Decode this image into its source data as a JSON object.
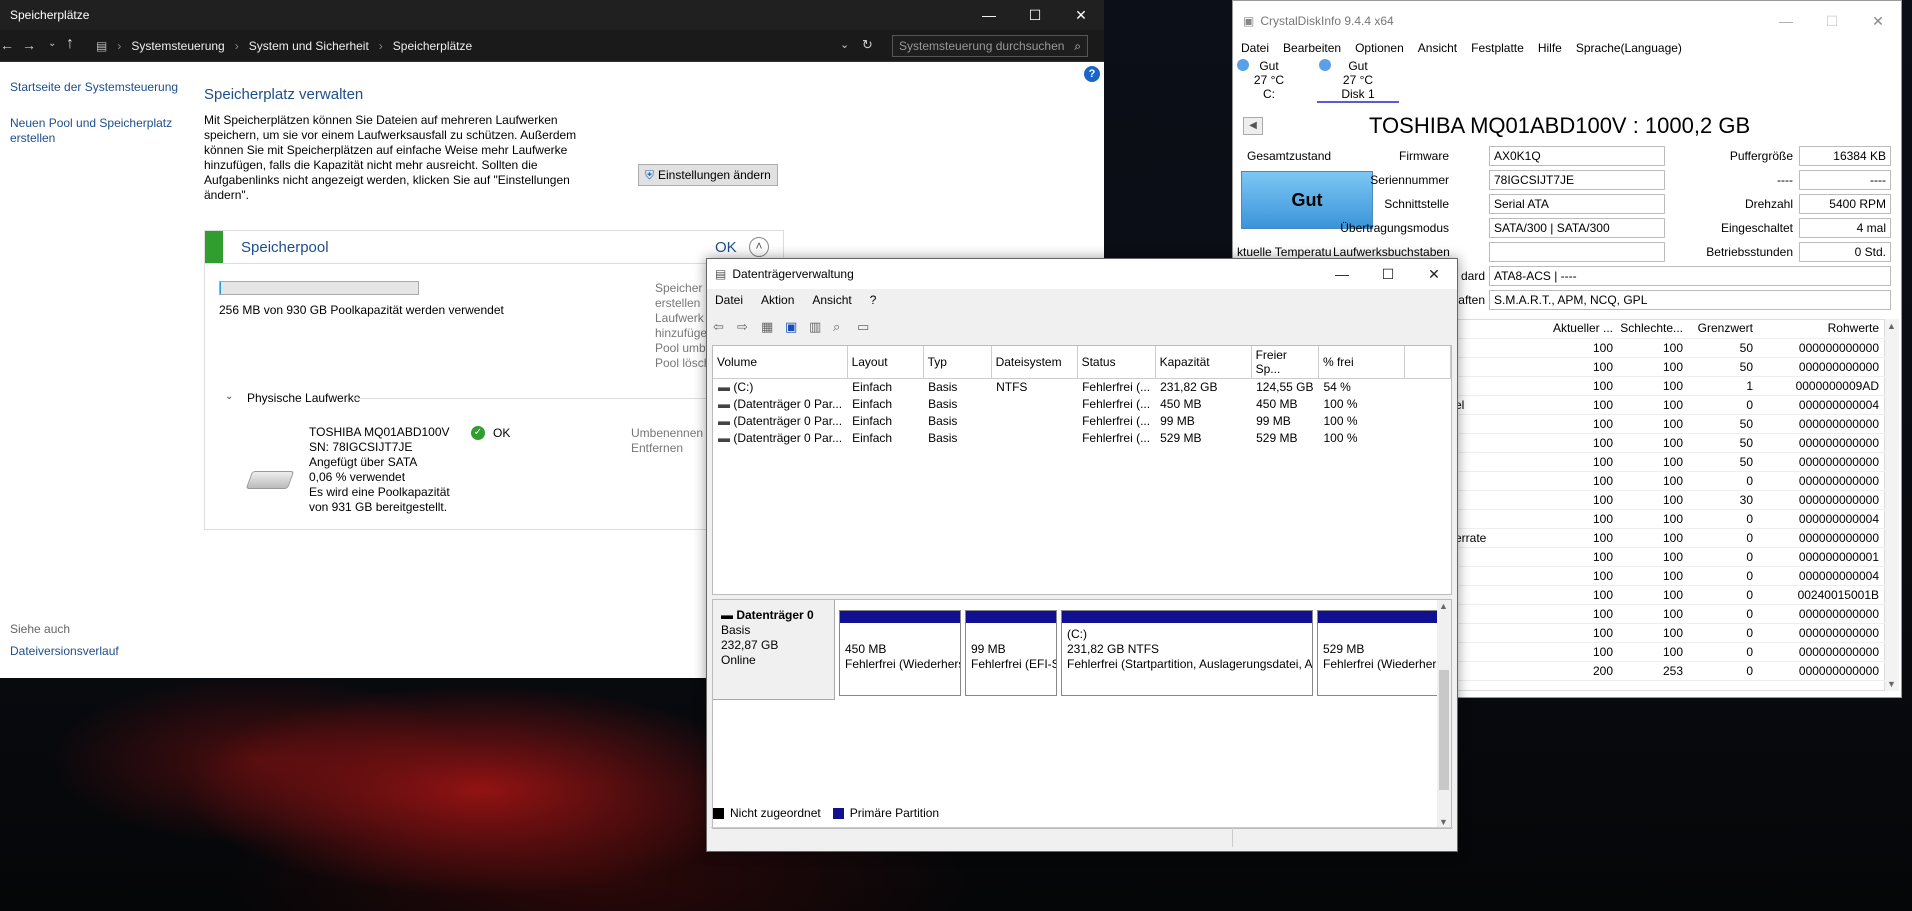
{
  "storage_spaces": {
    "window_title": "Speicherplätze",
    "breadcrumb": [
      "Systemsteuerung",
      "System und Sicherheit",
      "Speicherplätze"
    ],
    "search_placeholder": "Systemsteuerung durchsuchen",
    "side_links": [
      "Startseite der Systemsteuerung",
      "Neuen Pool und Speicherplatz erstellen"
    ],
    "see_also_label": "Siehe auch",
    "see_also_link": "Dateiversionsverlauf",
    "heading": "Speicherplatz verwalten",
    "description": "Mit Speicherplätzen können Sie Dateien auf mehreren Laufwerken speichern, um sie vor einem Laufwerksausfall zu schützen. Außerdem können Sie mit Speicherplätzen auf einfache Weise mehr Laufwerke hinzufügen, falls die Kapazität nicht mehr ausreicht. Sollten die Aufgabenlinks nicht angezeigt werden, klicken Sie auf \"Einstellungen ändern\".",
    "settings_button": "Einstellungen ändern",
    "pool": {
      "title": "Speicherpool",
      "status": "OK",
      "usage_text": "256 MB von 930 GB Poolkapazität werden verwendet",
      "usage_fraction": 0.0003,
      "pool_links": [
        "Speicher",
        "erstellen",
        "Laufwerk",
        "hinzufüge",
        "Pool umb",
        "Pool lösch"
      ],
      "physical_label": "Physische Laufwerke",
      "drive": {
        "name": "TOSHIBA MQ01ABD100V",
        "sn": "SN: 78IGCSIJT7JE",
        "attached": "Angefügt über SATA",
        "used": "0,06 % verwendet",
        "provided_1": "Es wird eine Poolkapazität",
        "provided_2": "von 931 GB bereitgestellt.",
        "status": "OK",
        "actions": [
          "Umbenennen",
          "Entfernen"
        ]
      }
    }
  },
  "crystal": {
    "window_title": "CrystalDiskInfo 9.4.4 x64",
    "menu": [
      "Datei",
      "Bearbeiten",
      "Optionen",
      "Ansicht",
      "Festplatte",
      "Hilfe",
      "Sprache(Language)"
    ],
    "disk_tabs": [
      {
        "status": "Gut",
        "temp": "27 °C",
        "label": "C:"
      },
      {
        "status": "Gut",
        "temp": "27 °C",
        "label": "Disk 1"
      }
    ],
    "model": "TOSHIBA MQ01ABD100V : 1000,2 GB",
    "health_label": "Gesamtzustand",
    "health_value": "Gut",
    "temp_label": "ktuelle Temperatu",
    "fields": [
      {
        "label": "Firmware",
        "value": "AX0K1Q"
      },
      {
        "label": "Seriennummer",
        "value": "78IGCSIJT7JE"
      },
      {
        "label": "Schnittstelle",
        "value": "Serial ATA"
      },
      {
        "label": "Übertragungsmodus",
        "value": "SATA/300 | SATA/300"
      },
      {
        "label": "Laufwerksbuchstaben",
        "value": ""
      },
      {
        "label": "dard",
        "value": "ATA8-ACS | ----"
      },
      {
        "label": "aften",
        "value": "S.M.A.R.T., APM, NCQ, GPL"
      }
    ],
    "right_fields": [
      {
        "label": "Puffergröße",
        "value": "16384 KB"
      },
      {
        "label": "----",
        "value": "----"
      },
      {
        "label": "Drehzahl",
        "value": "5400 RPM"
      },
      {
        "label": "Eingeschaltet",
        "value": "4 mal"
      },
      {
        "label": "Betriebsstunden",
        "value": "0 Std."
      }
    ],
    "smart_headers": [
      "Aktueller ...",
      "Schlechte...",
      "Grenzwert",
      "Rohwerte"
    ],
    "smart_rows": [
      {
        "name": "",
        "cur": "100",
        "worst": "100",
        "thr": "50",
        "raw": "000000000000"
      },
      {
        "name": "",
        "cur": "100",
        "worst": "100",
        "thr": "50",
        "raw": "000000000000"
      },
      {
        "name": "",
        "cur": "100",
        "worst": "100",
        "thr": "1",
        "raw": "0000000009AD"
      },
      {
        "name": "el",
        "cur": "100",
        "worst": "100",
        "thr": "0",
        "raw": "000000000004"
      },
      {
        "name": "",
        "cur": "100",
        "worst": "100",
        "thr": "50",
        "raw": "000000000000"
      },
      {
        "name": "",
        "cur": "100",
        "worst": "100",
        "thr": "50",
        "raw": "000000000000"
      },
      {
        "name": "",
        "cur": "100",
        "worst": "100",
        "thr": "50",
        "raw": "000000000000"
      },
      {
        "name": "",
        "cur": "100",
        "worst": "100",
        "thr": "0",
        "raw": "000000000000"
      },
      {
        "name": "",
        "cur": "100",
        "worst": "100",
        "thr": "30",
        "raw": "000000000000"
      },
      {
        "name": "",
        "cur": "100",
        "worst": "100",
        "thr": "0",
        "raw": "000000000004"
      },
      {
        "name": "errate",
        "cur": "100",
        "worst": "100",
        "thr": "0",
        "raw": "000000000000"
      },
      {
        "name": "",
        "cur": "100",
        "worst": "100",
        "thr": "0",
        "raw": "000000000001"
      },
      {
        "name": "",
        "cur": "100",
        "worst": "100",
        "thr": "0",
        "raw": "000000000004"
      },
      {
        "name": "",
        "cur": "100",
        "worst": "100",
        "thr": "0",
        "raw": "00240015001B"
      },
      {
        "name": "",
        "cur": "100",
        "worst": "100",
        "thr": "0",
        "raw": "000000000000"
      },
      {
        "name": "",
        "cur": "100",
        "worst": "100",
        "thr": "0",
        "raw": "000000000000"
      },
      {
        "name": "",
        "cur": "100",
        "worst": "100",
        "thr": "0",
        "raw": "000000000000"
      },
      {
        "name": "",
        "cur": "200",
        "worst": "253",
        "thr": "0",
        "raw": "000000000000"
      }
    ]
  },
  "diskmgmt": {
    "window_title": "Datenträgerverwaltung",
    "menu": [
      "Datei",
      "Aktion",
      "Ansicht",
      "?"
    ],
    "columns": [
      "Volume",
      "Layout",
      "Typ",
      "Dateisystem",
      "Status",
      "Kapazität",
      "Freier Sp...",
      "% frei"
    ],
    "volumes": [
      [
        "(C:)",
        "Einfach",
        "Basis",
        "NTFS",
        "Fehlerfrei (...",
        "231,82 GB",
        "124,55 GB",
        "54 %"
      ],
      [
        "(Datenträger 0 Par...",
        "Einfach",
        "Basis",
        "",
        "Fehlerfrei (...",
        "450 MB",
        "450 MB",
        "100 %"
      ],
      [
        "(Datenträger 0 Par...",
        "Einfach",
        "Basis",
        "",
        "Fehlerfrei (...",
        "99 MB",
        "99 MB",
        "100 %"
      ],
      [
        "(Datenträger 0 Par...",
        "Einfach",
        "Basis",
        "",
        "Fehlerfrei (...",
        "529 MB",
        "529 MB",
        "100 %"
      ]
    ],
    "disk": {
      "name": "Datenträger 0",
      "type": "Basis",
      "size": "232,87 GB",
      "state": "Online"
    },
    "partitions": [
      {
        "title": "",
        "size": "450 MB",
        "status": "Fehlerfrei (Wiederherstellungspartition)"
      },
      {
        "title": "",
        "size": "99 MB",
        "status": "Fehlerfrei (EFI-Systempartition)"
      },
      {
        "title": "(C:)",
        "size": "231,82 GB NTFS",
        "status": "Fehlerfrei (Startpartition, Auslagerungsdatei, Absturzabbild, Primäre Partition)"
      },
      {
        "title": "",
        "size": "529 MB",
        "status": "Fehlerfrei (Wiederherstellungspartition)"
      }
    ],
    "legend": [
      "Nicht zugeordnet",
      "Primäre Partition"
    ],
    "colors": {
      "unallocated": "#000000",
      "primary": "#101090"
    }
  }
}
